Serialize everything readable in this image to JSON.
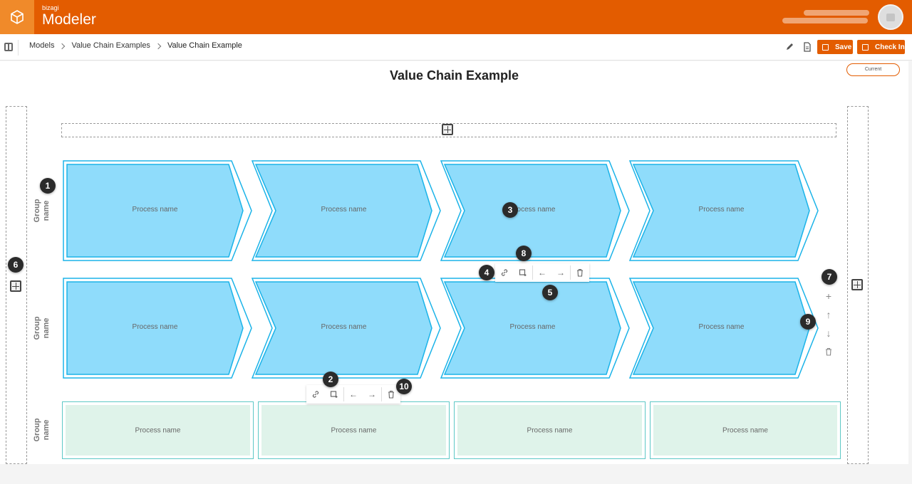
{
  "app": {
    "brand_small": "bizagi",
    "brand_name": "Modeler"
  },
  "breadcrumb": {
    "items": [
      "Models",
      "Value Chain Examples"
    ],
    "current": "Value Chain Example"
  },
  "toolbar": {
    "save_label": "Save",
    "checkin_label": "Check In"
  },
  "diagram": {
    "title": "Value Chain Example",
    "version_label": "Current",
    "groups": [
      {
        "label": "Group\nname",
        "processes": [
          "Process name",
          "Process name",
          "Process name",
          "Process name"
        ]
      },
      {
        "label": "Group\nname",
        "processes": [
          "Process name",
          "Process name",
          "Process name",
          "Process name"
        ]
      },
      {
        "label": "Group\nname",
        "processes": [
          "Process name",
          "Process name",
          "Process name",
          "Process name"
        ]
      }
    ]
  },
  "callouts": [
    "1",
    "2",
    "3",
    "4",
    "5",
    "6",
    "7",
    "8",
    "9",
    "10"
  ],
  "colors": {
    "brand": "#e35c00",
    "chevron_fill": "#8fdcfb",
    "chevron_stroke": "#1bb3e8",
    "support_fill": "#dff3ea",
    "support_stroke": "#5dc8c6"
  },
  "icons": {
    "element_toolbar": [
      "link-icon",
      "add-subprocess-icon",
      "arrow-left-icon",
      "arrow-right-icon",
      "trash-icon"
    ],
    "group_toolbar": [
      "plus-icon",
      "arrow-up-icon",
      "arrow-down-icon",
      "trash-icon"
    ]
  }
}
